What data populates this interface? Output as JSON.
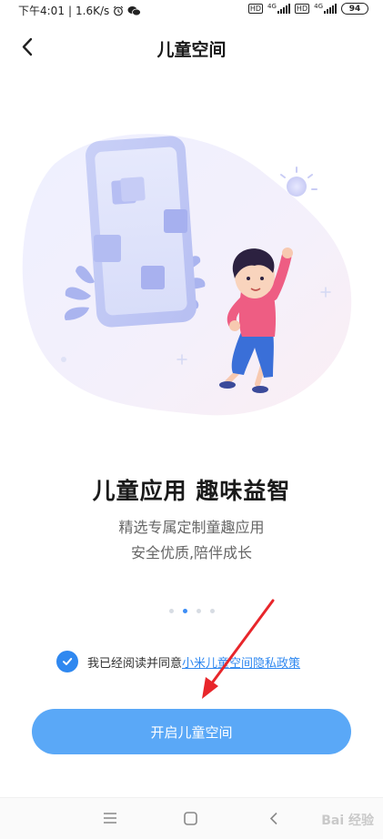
{
  "status_bar": {
    "time": "下午4:01",
    "speed": "1.6K/s",
    "alarm_icon": "alarm-icon",
    "wechat_icon": "wechat-icon",
    "network1": "4G",
    "network2": "4G",
    "battery": "94"
  },
  "header": {
    "back_icon": "back-arrow-icon",
    "title": "儿童空间"
  },
  "main": {
    "headline": "儿童应用 趣味益智",
    "subtitle_line1": "精选专属定制童趣应用",
    "subtitle_line2": "安全优质,陪伴成长",
    "page_dots": {
      "count": 4,
      "active_index": 1
    }
  },
  "agreement": {
    "checked": true,
    "text": "我已经阅读并同意",
    "link_text": "小米儿童空间隐私政策"
  },
  "primary_button": {
    "label": "开启儿童空间"
  },
  "nav_bar": {
    "menu_icon": "menu-icon",
    "home_icon": "home-icon",
    "back_icon": "back-icon",
    "watermark": "Bai 经验"
  },
  "colors": {
    "accent": "#2f88f0",
    "button": "#5aa8f7",
    "annotation_arrow": "#e8262b"
  }
}
